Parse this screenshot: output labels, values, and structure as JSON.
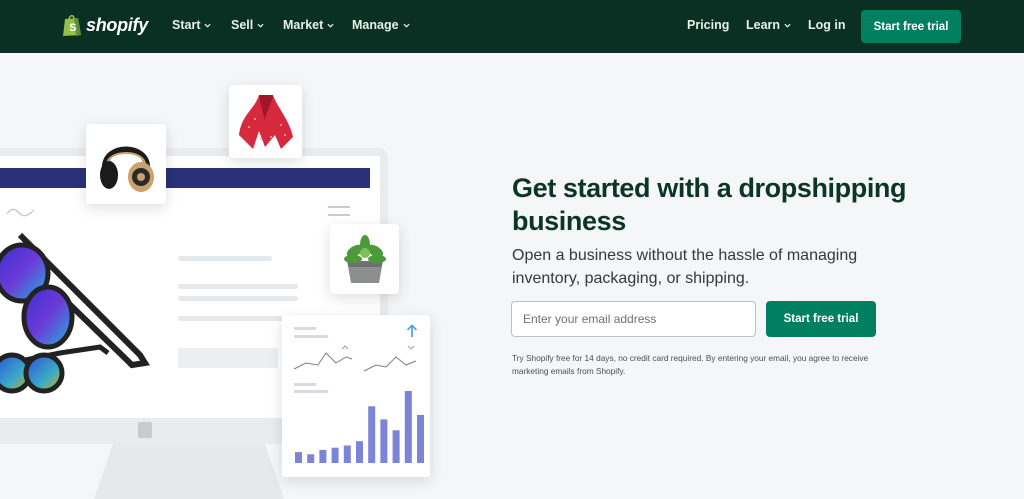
{
  "nav": {
    "logo_text": "shopify",
    "items": [
      {
        "label": "Start",
        "dropdown": true
      },
      {
        "label": "Sell",
        "dropdown": true
      },
      {
        "label": "Market",
        "dropdown": true
      },
      {
        "label": "Manage",
        "dropdown": true
      }
    ],
    "right_items": [
      {
        "label": "Pricing",
        "dropdown": false
      },
      {
        "label": "Learn",
        "dropdown": true
      },
      {
        "label": "Log in",
        "dropdown": false
      }
    ],
    "cta_label": "Start free trial"
  },
  "hero": {
    "headline": "Get started with a dropshipping business",
    "subheadline": "Open a business without the hassle of managing inventory, packaging, or shipping.",
    "email_placeholder": "Enter your email address",
    "email_value": "",
    "cta_label": "Start free trial",
    "disclaimer": "Try Shopify free for 14 days, no credit card required. By entering your email, you agree to receive marketing emails from Shopify."
  },
  "illustration": {
    "products": [
      "headphones-image",
      "scarf-image",
      "succulent-image",
      "sunglasses-image"
    ],
    "bar_chart_values": [
      5,
      4,
      6,
      7,
      8,
      10,
      26,
      20,
      15,
      33,
      22
    ]
  },
  "colors": {
    "nav_bg": "#0a3023",
    "brand_green": "#008060",
    "headline": "#0b3524",
    "page_bg": "#f4f6f8",
    "chart_bar": "#7b84d6"
  }
}
